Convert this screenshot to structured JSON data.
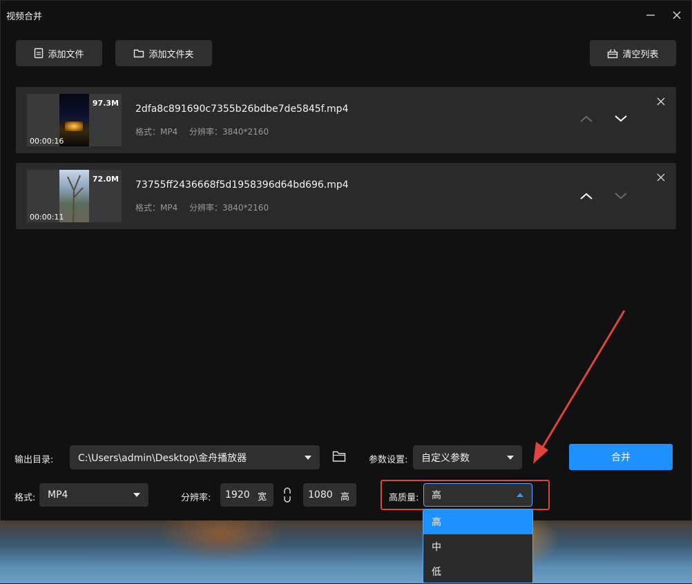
{
  "window": {
    "title": "视频合并"
  },
  "toolbar": {
    "add_file": "添加文件",
    "add_folder": "添加文件夹",
    "clear_list": "清空列表"
  },
  "files": [
    {
      "name": "2dfa8c891690c7355b26bdbe7de5845f.mp4",
      "format_label": "格式：MP4",
      "resolution_label": "分辨率：3840*2160",
      "size": "97.3M",
      "duration": "00:00:16"
    },
    {
      "name": "73755ff2436668f5d1958396d64bd696.mp4",
      "format_label": "格式：MP4",
      "resolution_label": "分辨率：3840*2160",
      "size": "72.0M",
      "duration": "00:00:11"
    }
  ],
  "output": {
    "dir_label": "输出目录:",
    "dir_value": "C:\\Users\\admin\\Desktop\\金舟播放器",
    "params_label": "参数设置:",
    "params_value": "自定义参数",
    "merge_label": "合并",
    "format_label": "格式:",
    "format_value": "MP4",
    "resolution_label": "分辨率:",
    "width_value": "1920",
    "width_unit": "宽",
    "height_value": "1080",
    "height_unit": "高",
    "quality_label": "高质量:",
    "quality_value": "高",
    "quality_options": [
      "高",
      "中",
      "低"
    ]
  },
  "colors": {
    "accent": "#1e90ff",
    "highlight_box": "#e0443a"
  }
}
